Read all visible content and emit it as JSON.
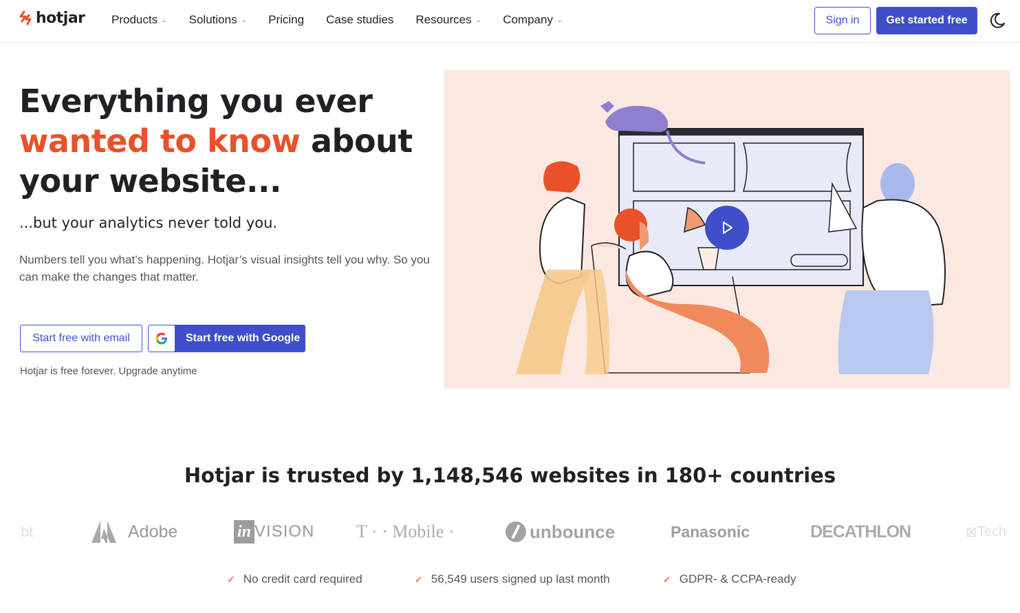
{
  "nav": {
    "logo_text": "hotjar",
    "items": [
      {
        "label": "Products",
        "dropdown": true
      },
      {
        "label": "Solutions",
        "dropdown": true
      },
      {
        "label": "Pricing",
        "dropdown": false
      },
      {
        "label": "Case studies",
        "dropdown": false
      },
      {
        "label": "Resources",
        "dropdown": true
      },
      {
        "label": "Company",
        "dropdown": true
      }
    ],
    "signin_label": "Sign in",
    "get_started_label": "Get started free",
    "theme_icon": "moon-icon"
  },
  "hero": {
    "title_line1": "Everything you ever",
    "title_accent": "wanted to know",
    "title_rest": " about",
    "title_line3": "your website...",
    "subtitle": "...but your analytics never told you.",
    "description": "Numbers tell you what’s happening. Hotjar’s visual insights tell you why. So you can make the changes that matter.",
    "email_button": "Start free with email",
    "google_button": "Start free with Google",
    "free_note": "Hotjar is free forever. Upgrade anytime"
  },
  "trust": {
    "headline": "Hotjar is trusted by 1,148,546 websites in 180+ countries",
    "logos": [
      "bt",
      "Adobe",
      "invision",
      "T · · Mobile ·",
      "unbounce",
      "Panasonic",
      "DECATHLON",
      "Tech"
    ],
    "checks": [
      "No credit card required",
      "56,549 users signed up last month",
      "GDPR- & CCPA-ready"
    ]
  },
  "colors": {
    "primary": "#3e4fc9",
    "accent": "#e8512a",
    "illustration_bg": "#fbe9e1"
  }
}
